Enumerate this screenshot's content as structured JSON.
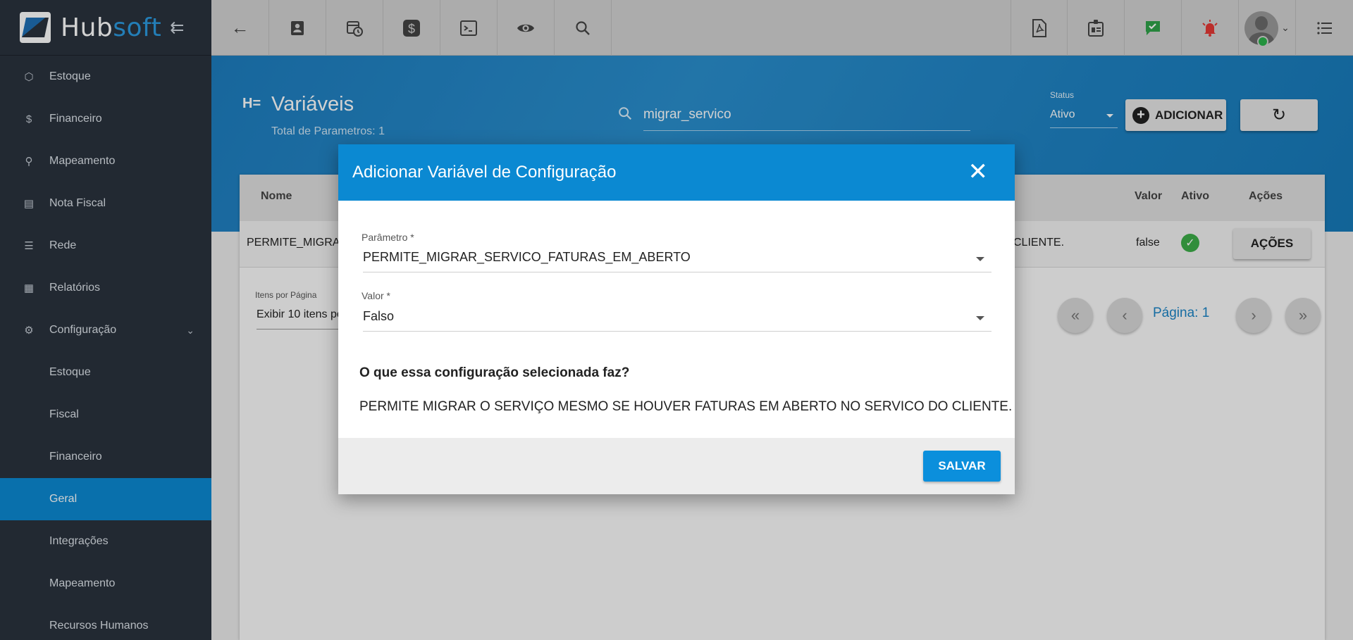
{
  "app": {
    "logo_part1": "Hub",
    "logo_part2": "soft"
  },
  "sidebar": {
    "items": [
      {
        "label": "Estoque",
        "icon": "box-icon"
      },
      {
        "label": "Financeiro",
        "icon": "money-icon"
      },
      {
        "label": "Mapeamento",
        "icon": "location-pin-icon"
      },
      {
        "label": "Nota Fiscal",
        "icon": "document-icon"
      },
      {
        "label": "Rede",
        "icon": "network-icon"
      },
      {
        "label": "Relatórios",
        "icon": "report-icon"
      },
      {
        "label": "Configuração",
        "icon": "gear-icon"
      }
    ],
    "subitems": [
      {
        "label": "Estoque"
      },
      {
        "label": "Fiscal"
      },
      {
        "label": "Financeiro"
      },
      {
        "label": "Geral",
        "active": true
      },
      {
        "label": "Integrações"
      },
      {
        "label": "Mapeamento"
      },
      {
        "label": "Recursos Humanos"
      }
    ]
  },
  "page": {
    "title": "Variáveis",
    "subtitle": "Total de Parametros: 1",
    "search_value": "migrar_servico",
    "status_label": "Status",
    "status_value": "Ativo",
    "add_label": "ADICIONAR"
  },
  "table": {
    "headers": {
      "nome": "Nome",
      "valor": "Valor",
      "ativo": "Ativo",
      "acoes": "Ações"
    },
    "row": {
      "nome": "PERMITE_MIGRAR",
      "descricao_tail": "CLIENTE.",
      "valor": "false",
      "acoes_label": "AÇÕES"
    },
    "perpage_label": "Itens por Página",
    "perpage_value": "Exibir 10 itens po",
    "page_label": "Página: 1"
  },
  "modal": {
    "title": "Adicionar Variável de Configuração",
    "parametro_label": "Parâmetro *",
    "parametro_value": "PERMITE_MIGRAR_SERVICO_FATURAS_EM_ABERTO",
    "valor_label": "Valor *",
    "valor_value": "Falso",
    "question": "O que essa configuração selecionada faz?",
    "answer": "PERMITE MIGRAR O SERVIÇO MESMO SE HOUVER FATURAS EM ABERTO NO SERVICO DO CLIENTE.",
    "save_label": "SALVAR"
  },
  "colors": {
    "primary": "#0b89d2",
    "sidebar_bg": "#2a323d",
    "success": "#3cae48",
    "alert": "#e53935"
  }
}
